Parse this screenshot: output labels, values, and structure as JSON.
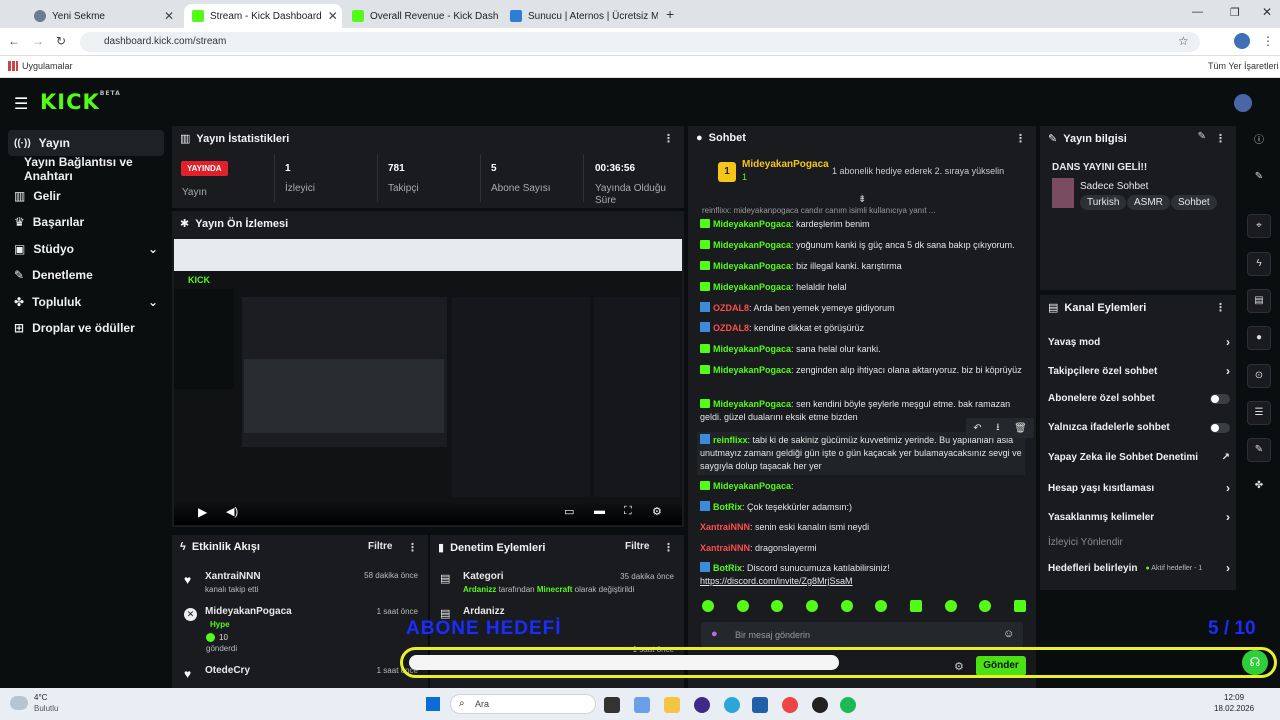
{
  "browser": {
    "tabs": [
      {
        "title": "Yeni Sekme"
      },
      {
        "title": "Stream - Kick Dashboard"
      },
      {
        "title": "Overall Revenue - Kick Dashbo"
      },
      {
        "title": "Sunucu | Aternos | Ücretsiz Min"
      }
    ],
    "url": "dashboard.kick.com/stream",
    "bookmarks": {
      "apps": "Uygulamalar",
      "all": "Tüm Yer İşaretleri"
    }
  },
  "header": {
    "logo": "KICK",
    "logo_tag": "BETA"
  },
  "sidebar": {
    "items": [
      {
        "label": "Yayın",
        "icon": "broadcast-icon"
      },
      {
        "label": "Yayın Bağlantısı ve Anahtarı",
        "icon": ""
      },
      {
        "label": "Gelir",
        "icon": "chart-icon"
      },
      {
        "label": "Başarılar",
        "icon": "trophy-icon"
      },
      {
        "label": "Stüdyo",
        "icon": "studio-icon"
      },
      {
        "label": "Denetleme",
        "icon": "wrench-icon"
      },
      {
        "label": "Topluluk",
        "icon": "community-icon"
      },
      {
        "label": "Droplar ve ödüller",
        "icon": "gift-icon"
      }
    ]
  },
  "stats": {
    "title": "Yayın İstatistikleri",
    "live_badge": "YAYINDA",
    "status_label": "Yayın",
    "items": [
      {
        "value": "1",
        "label": "İzleyici"
      },
      {
        "value": "781",
        "label": "Takipçi"
      },
      {
        "value": "5",
        "label": "Abone Sayısı"
      },
      {
        "value": "00:36:56",
        "label": "Yayında Olduğu Süre"
      }
    ]
  },
  "preview": {
    "title": "Yayın Ön İzlemesi"
  },
  "activity": {
    "title": "Etkinlik Akışı",
    "filter": "Filtre",
    "items": [
      {
        "user": "XantraiNNN",
        "text": "kanalı takip etti",
        "time": "58 dakika önce"
      },
      {
        "user": "MideyakanPogaca",
        "hype": "Hype",
        "count": "10",
        "text": "gönderdi",
        "time": "1 saat önce"
      },
      {
        "user": "OtedeCry",
        "text": "",
        "time": "1 saat önce"
      }
    ]
  },
  "moderation": {
    "title": "Denetim Eylemleri",
    "filter": "Filtre",
    "items": [
      {
        "title": "Kategori",
        "user": "Ardanizz",
        "mid": "tarafından",
        "category": "Minecraft",
        "suffix": "olarak değiştirildi",
        "time": "35 dakika önce"
      },
      {
        "title": "Ardanizz",
        "user": "",
        "mid": "",
        "category": "",
        "suffix": "",
        "time": "1 saat önce"
      }
    ]
  },
  "chat": {
    "title": "Sohbet",
    "gifter": "MideyakanPogaca",
    "gifter_count": "1",
    "gift_text": "1 abonelik hediye ederek 2. sıraya yükselin",
    "reply_text": "reinflixx: mideyakanpogaca candır canım isimli kullanıcıya yanıt ...",
    "messages": [
      {
        "user": "MideyakanPogaca",
        "text": "kardeşlerim benim",
        "red": false
      },
      {
        "user": "MideyakanPogaca",
        "text": "yoğunum kanki iş güç anca 5 dk sana bakıp çıkıyorum.",
        "red": false
      },
      {
        "user": "MideyakanPogaca",
        "text": "biz illegal kanki. karıştırma",
        "red": false
      },
      {
        "user": "MideyakanPogaca",
        "text": "helaldir helal",
        "red": false
      },
      {
        "user": "OZDAL8",
        "text": "Arda ben yemek yemeye gidiyorum",
        "red": true
      },
      {
        "user": "OZDAL8",
        "text": "kendine dikkat et görüşürüz",
        "red": true
      },
      {
        "user": "MideyakanPogaca",
        "text": "sana helal olur kanki.",
        "red": false
      },
      {
        "user": "MideyakanPogaca",
        "text": "zenginden alıp ihtiyacı olana aktarıyoruz. biz bi köprüyüz",
        "red": false
      },
      {
        "user": "MideyakanPogaca",
        "text": "sen kendini böyle şeylerle meşgul etme. bak ramazan geldi. güzel dualarını eksik etme bizden",
        "red": false
      },
      {
        "user": "reinflixx",
        "text": "tabi ki de sakiniz gücümüz kuvvetimiz yerinde. Bu yapılanları asla unutmayız zamanı geldiği gün işte o gün kaçacak yer bulamayacaksınız sevgi ve saygıyla dolup taşacak her yer",
        "red": false
      },
      {
        "user": "MideyakanPogaca",
        "text": "",
        "red": false
      },
      {
        "user": "BotRix",
        "text": "Çok teşekkürler adamsın:)",
        "red": false
      },
      {
        "user": "XantraiNNN",
        "text": "senin eski kanalın ismi neydi",
        "red": true
      },
      {
        "user": "XantraiNNN",
        "text": "dragonslayermi",
        "red": true
      },
      {
        "user": "BotRix",
        "text": "Discord sunucumuza katılabilirsiniz!",
        "link": "https://discord.com/invite/Zg8MrjSsaM",
        "red": false
      }
    ],
    "input_placeholder": "Bir mesaj gönderin",
    "send": "Gönder"
  },
  "info": {
    "title": "Yayın bilgisi",
    "stream_title": "DANS YAYINI GELİ!!",
    "category": "Sadece Sohbet",
    "tags": [
      "Turkish",
      "ASMR",
      "Sohbet"
    ]
  },
  "channel_actions": {
    "title": "Kanal Eylemleri",
    "items": [
      {
        "label": "Yavaş mod",
        "kind": "chev"
      },
      {
        "label": "Takipçilere özel sohbet",
        "kind": "chev"
      },
      {
        "label": "Abonelere özel sohbet",
        "kind": "toggle"
      },
      {
        "label": "Yalnızca ifadelerle sohbet",
        "kind": "toggle"
      },
      {
        "label": "Yapay Zeka ile Sohbet Denetimi",
        "kind": "ext"
      },
      {
        "label": "Hesap yaşı kısıtlaması",
        "kind": "chev"
      },
      {
        "label": "Yasaklanmış kelimeler",
        "kind": "chev"
      }
    ],
    "section": "İzleyici Yönlendir",
    "goal_label": "Hedefleri belirleyin",
    "goal_status": "Aktif hedefler - 1"
  },
  "overlay": {
    "goal_text": "ABONE HEDEFİ",
    "goal_count": "5 / 10"
  },
  "taskbar": {
    "weather_temp": "4°C",
    "weather_text": "Bulutlu",
    "search": "Ara",
    "time": "12:09",
    "date": "18.02.2026"
  },
  "colors": {
    "kick_green": "#53fc18",
    "panel": "#191b1f",
    "background": "#0b0e0f"
  }
}
